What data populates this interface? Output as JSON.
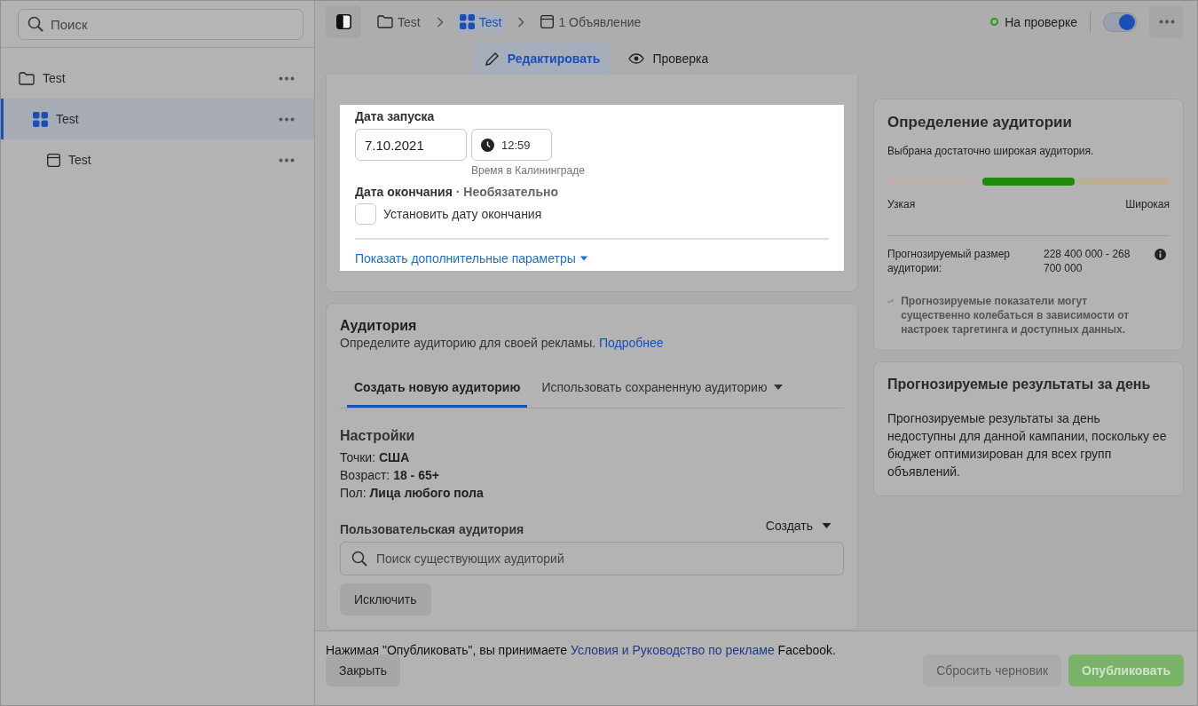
{
  "sidebar": {
    "search": {
      "placeholder": "Поиск"
    },
    "items": [
      {
        "label": "Test",
        "kind": "campaign",
        "selected": false,
        "children": [
          {
            "label": "Test",
            "kind": "adset",
            "selected": true,
            "children": [
              {
                "label": "Test",
                "kind": "ad",
                "selected": false
              }
            ]
          }
        ]
      }
    ]
  },
  "topbar": {
    "breadcrumbs": [
      {
        "label": "Test",
        "kind": "campaign",
        "selected": false
      },
      {
        "label": "Test",
        "kind": "adset",
        "selected": true
      },
      {
        "label": "1 Объявление",
        "kind": "ad",
        "selected": false
      }
    ],
    "status": {
      "label": "На проверке",
      "color": "#2a9d0a"
    },
    "toggle": {
      "on": true
    }
  },
  "mode_tabs": [
    {
      "label": "Редактировать",
      "kind": "edit",
      "selected": true
    },
    {
      "label": "Проверка",
      "kind": "review",
      "selected": false
    }
  ],
  "schedule": {
    "start_label": "Дата запуска",
    "start_date": "7.10.2021",
    "start_time": "12:59",
    "timezone_note": "Время в Калининграде",
    "end_label": "Дата окончания",
    "end_optional": "· Необязательно",
    "end_checkbox": {
      "label": "Установить дату окончания",
      "checked": false
    },
    "more_link": "Показать дополнительные параметры"
  },
  "audience": {
    "title": "Аудитория",
    "description": "Определите аудиторию для своей рекламы.",
    "learn_more": "Подробнее",
    "tabs": [
      {
        "label": "Создать новую аудиторию",
        "selected": true,
        "dropdown": false
      },
      {
        "label": "Использовать сохраненную аудиторию",
        "selected": false,
        "dropdown": true
      }
    ],
    "settings_title": "Настройки",
    "settings": [
      "Точки: **США**",
      "Возраст: **18 - 65+**",
      "Пол: **Лица любого пола**"
    ],
    "custom_audience_label": "Пользовательская аудитория",
    "create_button": "Создать",
    "search": {
      "placeholder": "Поиск существующих аудиторий"
    },
    "exclude_button": "Исключить"
  },
  "audience_definition": {
    "title": "Определение аудитории",
    "summary": "Выбрана достаточно широкая аудитория.",
    "meter": [
      {
        "selected": false,
        "color": "#c0b0b0"
      },
      {
        "selected": true,
        "color": "#1f8a0a"
      },
      {
        "selected": false,
        "color": "#bdb08e"
      }
    ],
    "narrow_label": "Узкая",
    "wide_label": "Широкая",
    "size_label": "Прогнозируемый размер аудитории:",
    "size_value": "228 400 000 - 268 700 000",
    "note": "Прогнозируемые показатели могут существенно колебаться в зависимости от настроек таргетинга и доступных данных."
  },
  "daily_results": {
    "title": "Прогнозируемые результаты за день",
    "text": "Прогнозируемые результаты за день недоступны для данной кампании, поскольку ее бюджет оптимизирован для всех групп объявлений."
  },
  "footer": {
    "terms_before": "Нажимая \"Опубликовать\", вы принимаете",
    "terms_link": "Условия и Руководство по рекламе",
    "terms_after": "Facebook.",
    "buttons": [
      {
        "label": "Закрыть",
        "kind": "secondary",
        "disabled": false
      },
      {
        "label": "Сбросить черновик",
        "kind": "secondary",
        "disabled": true
      },
      {
        "label": "Опубликовать",
        "kind": "primary",
        "disabled": true
      }
    ]
  }
}
